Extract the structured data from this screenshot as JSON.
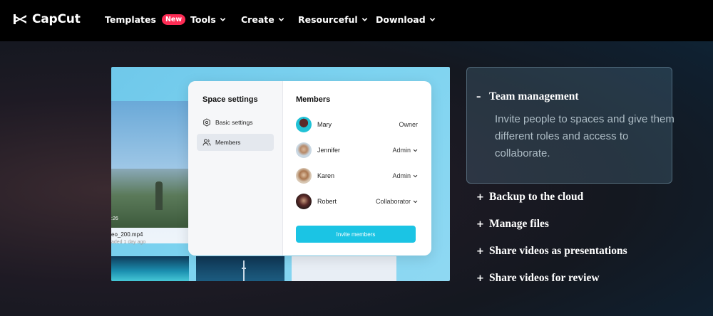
{
  "nav": {
    "brand": "CapCut",
    "items": [
      {
        "label": "Templates",
        "badge": "New"
      },
      {
        "label": "Tools"
      },
      {
        "label": "Create"
      },
      {
        "label": "Resourceful"
      },
      {
        "label": "Download"
      }
    ]
  },
  "illustration": {
    "file_name": "eo_200.mp4",
    "file_sub": "aded 1 day ago",
    "duration": ":26",
    "modal": {
      "title": "Space settings",
      "menu": [
        {
          "label": "Basic settings",
          "icon": "hexagon-gear-icon"
        },
        {
          "label": "Members",
          "icon": "users-icon",
          "active": true
        }
      ],
      "members_title": "Members",
      "members": [
        {
          "name": "Mary",
          "role": "Owner",
          "dropdown": false
        },
        {
          "name": "Jennifer",
          "role": "Admin",
          "dropdown": true
        },
        {
          "name": "Karen",
          "role": "Admin",
          "dropdown": true
        },
        {
          "name": "Robert",
          "role": "Collaborator",
          "dropdown": true
        }
      ],
      "invite_label": "Invite members"
    }
  },
  "features": {
    "active": {
      "sign": "–",
      "title": "Team management",
      "description": "Invite people to spaces and give them different roles and access to collaborate."
    },
    "items": [
      {
        "sign": "+",
        "title": "Backup to the cloud"
      },
      {
        "sign": "+",
        "title": "Manage files"
      },
      {
        "sign": "+",
        "title": "Share videos as presentations"
      },
      {
        "sign": "+",
        "title": "Share videos for review"
      }
    ]
  },
  "colors": {
    "accent": "#1bc4e4",
    "badge": "#fe2c55"
  }
}
